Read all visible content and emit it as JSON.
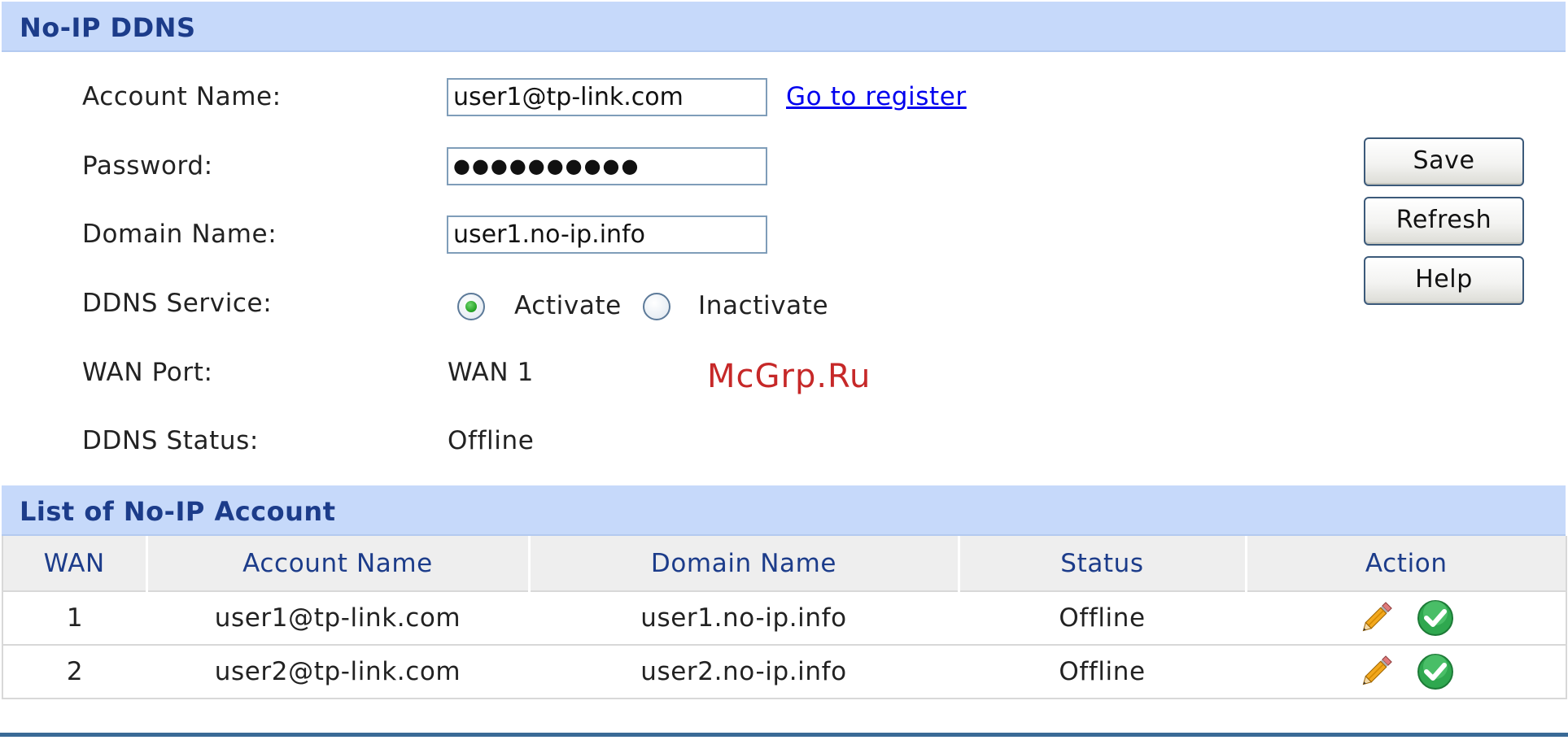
{
  "section1": {
    "title": "No-IP DDNS"
  },
  "form": {
    "account_name_label": "Account Name:",
    "account_name_value": "user1@tp-link.com",
    "register_link": "Go to register",
    "password_label": "Password:",
    "password_dots": "●●●●●●●●●●",
    "domain_name_label": "Domain Name:",
    "domain_name_value": "user1.no-ip.info",
    "ddns_service_label": "DDNS Service:",
    "activate_label": "Activate",
    "inactivate_label": "Inactivate",
    "ddns_service_selected": "Activate",
    "wan_port_label": "WAN Port:",
    "wan_port_value": "WAN 1",
    "ddns_status_label": "DDNS Status:",
    "ddns_status_value": "Offline"
  },
  "buttons": {
    "save": "Save",
    "refresh": "Refresh",
    "help": "Help"
  },
  "watermark": "McGrp.Ru",
  "section2": {
    "title": "List of No-IP Account"
  },
  "table": {
    "headers": [
      "WAN",
      "Account Name",
      "Domain Name",
      "Status",
      "Action"
    ],
    "rows": [
      {
        "wan": "1",
        "account": "user1@tp-link.com",
        "domain": "user1.no-ip.info",
        "status": "Offline",
        "actions": [
          "pencil-icon",
          "check-circle-icon"
        ]
      },
      {
        "wan": "2",
        "account": "user2@tp-link.com",
        "domain": "user2.no-ip.info",
        "status": "Offline",
        "actions": [
          "pencil-icon",
          "check-circle-icon"
        ]
      }
    ]
  },
  "colors": {
    "header_bg": "#c6d9fa",
    "header_text": "#1c3c8a",
    "link": "#0000ee",
    "watermark": "#c62828",
    "bottom_line": "#3a6a96"
  }
}
